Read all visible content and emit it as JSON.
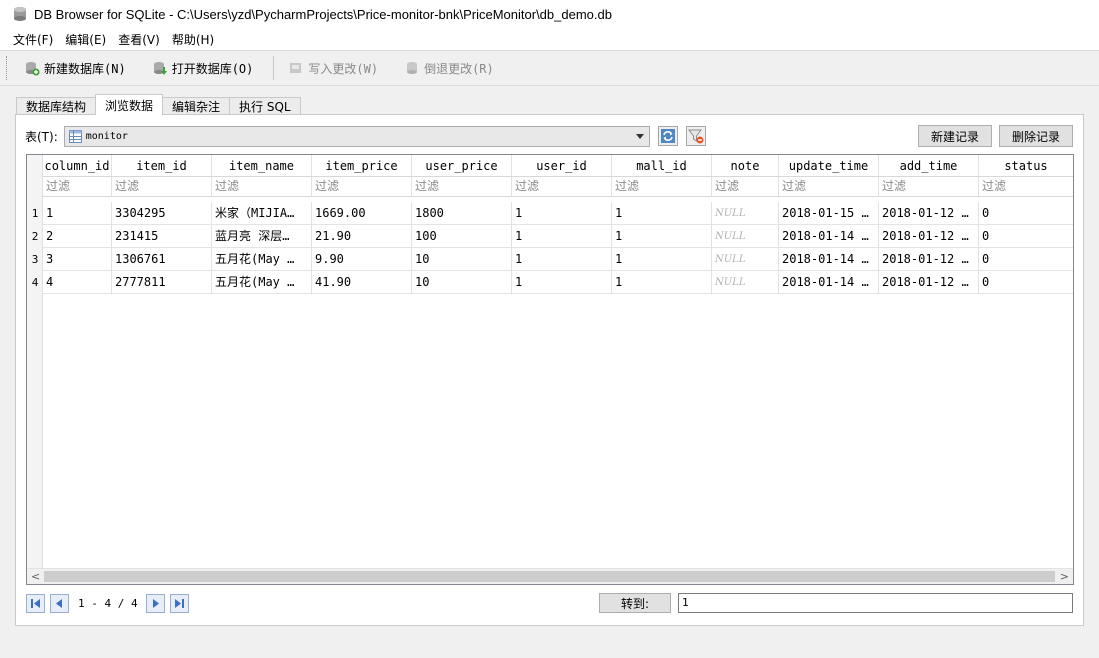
{
  "window": {
    "title": "DB Browser for SQLite - C:\\Users\\yzd\\PycharmProjects\\Price-monitor-bnk\\PriceMonitor\\db_demo.db"
  },
  "menu": [
    "文件(F)",
    "编辑(E)",
    "查看(V)",
    "帮助(H)"
  ],
  "toolbar": {
    "new_db": "新建数据库(N)",
    "open_db": "打开数据库(O)",
    "write_changes": "写入更改(W)",
    "revert_changes": "倒退更改(R)"
  },
  "tabs": [
    "数据库结构",
    "浏览数据",
    "编辑杂注",
    "执行 SQL"
  ],
  "browse": {
    "table_label": "表(T):",
    "table_name": "monitor",
    "new_record": "新建记录",
    "delete_record": "删除记录",
    "filter_placeholder": "过滤",
    "columns": [
      "column_id",
      "item_id",
      "item_name",
      "item_price",
      "user_price",
      "user_id",
      "mall_id",
      "note",
      "update_time",
      "add_time",
      "status"
    ],
    "rows": [
      {
        "num": "1",
        "cells": [
          "1",
          "3304295",
          "米家（MIJIA…",
          "1669.00",
          "1800",
          "1",
          "1",
          "NULL",
          "2018-01-15 …",
          "2018-01-12 …",
          "0"
        ]
      },
      {
        "num": "2",
        "cells": [
          "2",
          "231415",
          "蓝月亮 深层…",
          "21.90",
          "100",
          "1",
          "1",
          "NULL",
          "2018-01-14 …",
          "2018-01-12 …",
          "0"
        ]
      },
      {
        "num": "3",
        "cells": [
          "3",
          "1306761",
          "五月花(May …",
          "9.90",
          "10",
          "1",
          "1",
          "NULL",
          "2018-01-14 …",
          "2018-01-12 …",
          "0"
        ]
      },
      {
        "num": "4",
        "cells": [
          "4",
          "2777811",
          "五月花(May …",
          "41.90",
          "10",
          "1",
          "1",
          "NULL",
          "2018-01-14 …",
          "2018-01-12 …",
          "0"
        ]
      }
    ],
    "record_count": "1 - 4 / 4",
    "goto_label": "转到:",
    "goto_value": "1"
  },
  "colors": {
    "grid_border": "#828790",
    "nav_button": "#3a6fc4",
    "null_text": "#b0b0b0"
  }
}
